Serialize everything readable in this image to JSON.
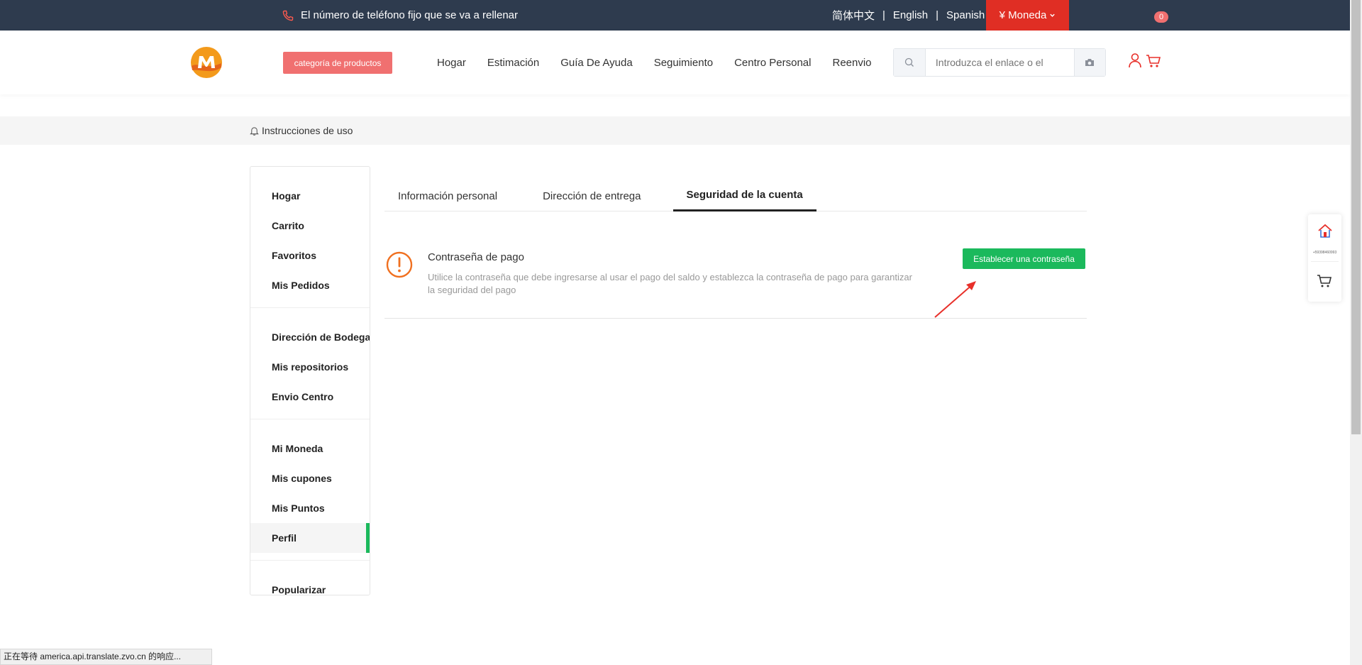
{
  "topbar": {
    "phone_text": "El número de teléfono fijo que se va a rellenar",
    "lang_zh": "简体中文",
    "lang_en": "English",
    "lang_es": "Spanish",
    "separator": "|",
    "currency": "¥ Moneda"
  },
  "header": {
    "category_button": "categoría de productos",
    "nav": [
      "Hogar",
      "Estimación",
      "Guía De Ayuda",
      "Seguimiento",
      "Centro Personal",
      "Reenvio"
    ],
    "search_placeholder": "Introduzca el enlace o el",
    "cart_count": "0"
  },
  "notice": {
    "text": "Instrucciones de uso"
  },
  "sidebar": {
    "groups": [
      [
        "Hogar",
        "Carrito",
        "Favoritos",
        "Mis Pedidos"
      ],
      [
        "Dirección de Bodega",
        "Mis repositorios",
        "Envio Centro"
      ],
      [
        "Mi Moneda",
        "Mis cupones",
        "Mis Puntos",
        "Perfil"
      ],
      [
        "Popularizar"
      ]
    ],
    "active": "Perfil"
  },
  "tabs": [
    "Información personal",
    "Dirección de entrega",
    "Seguridad de la cuenta"
  ],
  "active_tab": "Seguridad de la cuenta",
  "security": {
    "title": "Contraseña de pago",
    "description": "Utilice la contraseña que debe ingresarse al usar el pago del saldo y establezca la contraseña de pago para garantizar la seguridad del pago",
    "button": "Establecer una contraseña"
  },
  "float_widget": {
    "tiny_text": "+59398460993"
  },
  "statusbar": {
    "text": "正在等待 america.api.translate.zvo.cn 的响应..."
  },
  "colors": {
    "topbar_bg": "#2e3b4e",
    "currency_bg": "#e02e24",
    "category_btn": "#f07070",
    "accent_green": "#1bb95c",
    "warning_orange": "#f07020",
    "arrow_red": "#e8302a"
  },
  "icons": {
    "phone": "phone-icon",
    "search": "search-icon",
    "camera": "camera-icon",
    "user": "user-icon",
    "cart": "cart-icon",
    "bell": "bell-icon",
    "warning": "warning-circle-icon",
    "home": "home-icon"
  }
}
